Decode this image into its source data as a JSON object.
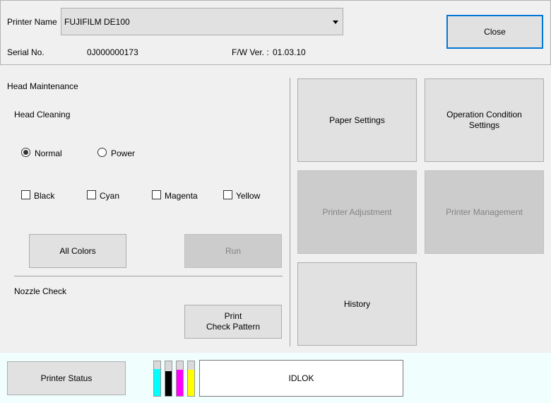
{
  "header": {
    "printer_name_label": "Printer Name",
    "printer_selected": "FUJIFILM DE100",
    "serial_label": "Serial No.",
    "serial_value": "0J000000173",
    "fw_label": "F/W Ver. :",
    "fw_value": "01.03.10",
    "close_label": "Close"
  },
  "head_maintenance": {
    "title": "Head Maintenance",
    "cleaning_title": "Head Cleaning",
    "modes": [
      {
        "label": "Normal",
        "checked": true
      },
      {
        "label": "Power",
        "checked": false
      }
    ],
    "colors": [
      {
        "label": "Black",
        "checked": false
      },
      {
        "label": "Cyan",
        "checked": false
      },
      {
        "label": "Magenta",
        "checked": false
      },
      {
        "label": "Yellow",
        "checked": false
      }
    ],
    "all_colors_label": "All Colors",
    "run_label": "Run",
    "nozzle_title": "Nozzle Check",
    "print_pattern_label": "Print\nCheck Pattern"
  },
  "menu": {
    "paper_settings": "Paper Settings",
    "operation_condition": "Operation Condition\nSettings",
    "printer_adjustment": "Printer Adjustment",
    "printer_management": "Printer Management",
    "history": "History"
  },
  "status": {
    "printer_status_label": "Printer Status",
    "status_text": "IDLOK",
    "inks": [
      {
        "name": "cyan",
        "color": "#00ffff",
        "level": 0.78
      },
      {
        "name": "black",
        "color": "#000000",
        "level": 0.72
      },
      {
        "name": "magenta",
        "color": "#ff00ff",
        "level": 0.76
      },
      {
        "name": "yellow",
        "color": "#ffff00",
        "level": 0.76
      }
    ]
  }
}
